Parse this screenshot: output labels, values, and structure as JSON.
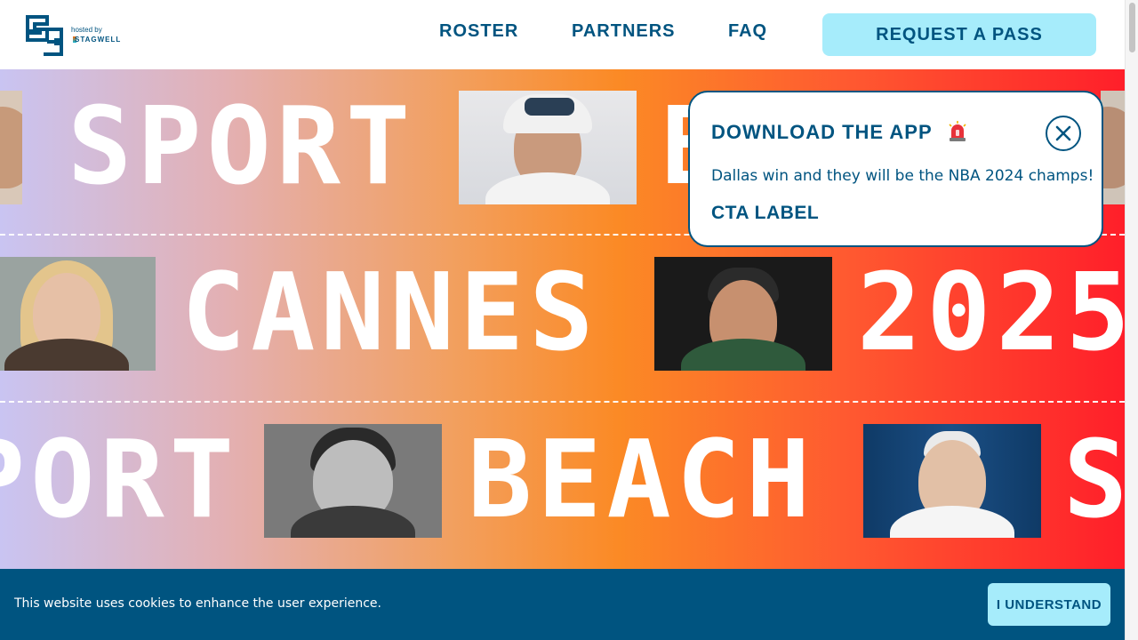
{
  "header": {
    "logo_hosted": "hosted by",
    "logo_stagwell": "STAGWELL",
    "nav": {
      "roster": "ROSTER",
      "partners": "PARTNERS",
      "faq": "FAQ"
    },
    "cta": "REQUEST A PASS"
  },
  "hero": {
    "row1": {
      "word1": "SPORT",
      "word2": "B"
    },
    "row2": {
      "word1": "CANNES",
      "word2": "2025"
    },
    "row3": {
      "word1": "PORT",
      "word2": "BEACH",
      "word3": "S"
    }
  },
  "popup": {
    "title": "DOWNLOAD THE APP",
    "icon": "siren-icon",
    "message": "Dallas win and they will be the NBA 2024 champs!",
    "cta": "CTA LABEL",
    "close_icon": "close-icon"
  },
  "cookie_bar": {
    "text": "This website uses cookies to enhance the user experience.",
    "button": "I UNDERSTAND"
  },
  "colors": {
    "brand_navy": "#005480",
    "accent_cyan": "#a6ecfb",
    "gradient_start": "#c9c4f2",
    "gradient_mid": "#fb8a25",
    "gradient_end": "#ff1f2a"
  }
}
